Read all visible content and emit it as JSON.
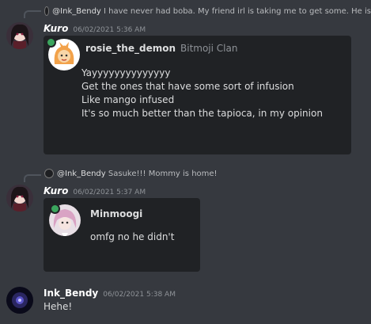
{
  "messages": [
    {
      "reply_name": "@Ink_Bendy",
      "reply_text": "I have never had boba. My friend irl is taking me to get some. He is",
      "author": "Kuro",
      "timestamp": "06/02/2021 5:36 AM",
      "embed": {
        "username": "rosie_the_demon",
        "clan": "Bitmoji Clan",
        "lines": [
          "Yayyyyyyyyyyyyyy",
          "Get the ones that have some sort of infusion",
          "Like mango infused",
          "It's so much better than the tapioca, in my opinion"
        ]
      }
    },
    {
      "reply_name": "@Ink_Bendy",
      "reply_text": "Sasuke!!! Mommy is home!",
      "author": "Kuro",
      "timestamp": "06/02/2021 5:37 AM",
      "embed": {
        "username": "Minmoogi",
        "lines": [
          "omfg no he didn't"
        ]
      }
    },
    {
      "author": "Ink_Bendy",
      "timestamp": "06/02/2021 5:38 AM",
      "text": "Hehe!"
    }
  ],
  "colors": {
    "background": "#36393f",
    "embed_background": "#202225",
    "online": "#3ba55d"
  }
}
